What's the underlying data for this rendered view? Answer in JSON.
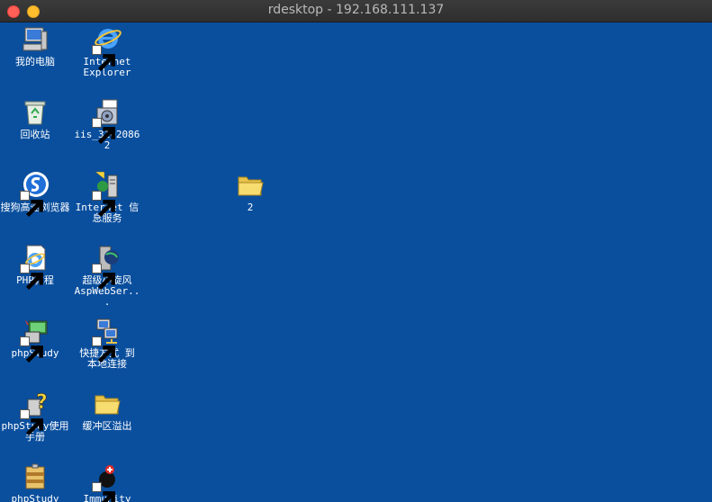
{
  "window": {
    "title": "rdesktop - 192.168.111.137"
  },
  "desktop": {
    "icons": [
      {
        "label": "我的电脑",
        "icon": "my-computer-icon"
      },
      {
        "label": "Internet Explorer",
        "icon": "internet-explorer-icon"
      },
      {
        "label": "回收站",
        "icon": "recycle-bin-icon"
      },
      {
        "label": "iis_31020862",
        "icon": "installer-icon"
      },
      {
        "label": "搜狗高速浏览器",
        "icon": "sogou-browser-icon"
      },
      {
        "label": "Internet 信息服务",
        "icon": "iis-manager-icon"
      },
      {
        "label": "2",
        "icon": "folder-icon"
      },
      {
        "label": "PHP教程",
        "icon": "php-tutorial-icon"
      },
      {
        "label": "超级小旋风 AspWebSer...",
        "icon": "aspwebserver-icon"
      },
      {
        "label": "phpStudy",
        "icon": "phpstudy-icon"
      },
      {
        "label": "快捷方式 到 本地连接",
        "icon": "network-connection-icon"
      },
      {
        "label": "phpStudy使用手册",
        "icon": "help-manual-icon"
      },
      {
        "label": "缓冲区溢出",
        "icon": "folder-icon"
      },
      {
        "label": "phpStudy",
        "icon": "phpstudy-package-icon"
      },
      {
        "label": "Immunity",
        "icon": "immunity-debugger-icon"
      }
    ]
  }
}
